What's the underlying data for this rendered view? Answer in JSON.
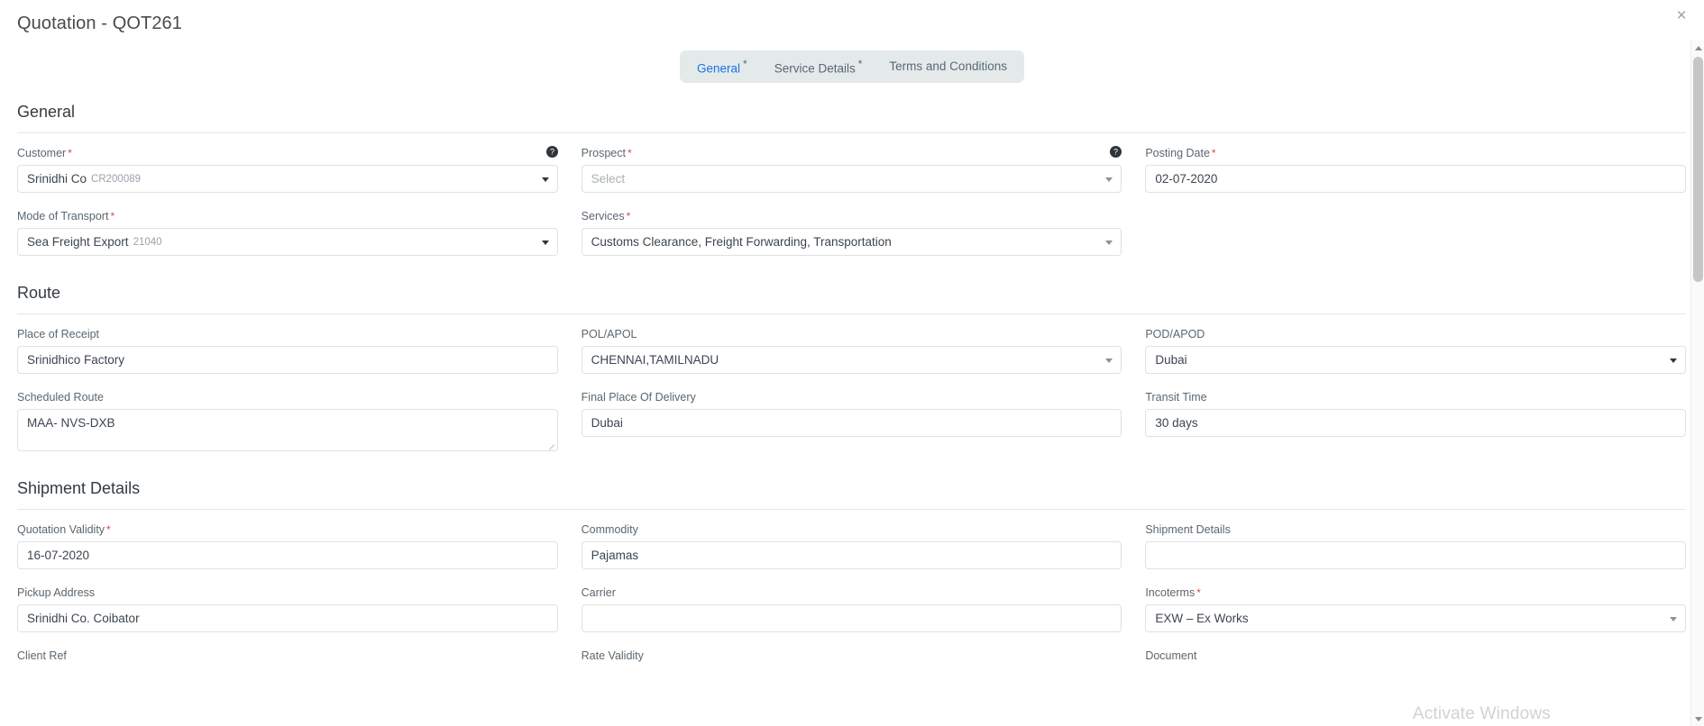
{
  "window": {
    "title": "Quotation - QOT261",
    "close_label": "×"
  },
  "tabs": [
    {
      "label": "General",
      "required_mark": "*",
      "active": true
    },
    {
      "label": "Service Details",
      "required_mark": "*",
      "active": false
    },
    {
      "label": "Terms and Conditions",
      "required_mark": "",
      "active": false
    }
  ],
  "sections": {
    "general": {
      "title": "General",
      "fields": {
        "customer": {
          "label": "Customer",
          "required": "*",
          "value": "Srinidhi Co",
          "value_code": "CR200089",
          "help": "help-icon"
        },
        "prospect": {
          "label": "Prospect",
          "required": "*",
          "placeholder": "Select",
          "help": "help-icon"
        },
        "posting_date": {
          "label": "Posting Date",
          "required": "*",
          "value": "02-07-2020"
        },
        "mode_of_transport": {
          "label": "Mode of Transport",
          "required": "*",
          "value": "Sea Freight Export",
          "value_code": "21040"
        },
        "services": {
          "label": "Services",
          "required": "*",
          "value": "Customs Clearance, Freight Forwarding, Transportation"
        }
      }
    },
    "route": {
      "title": "Route",
      "fields": {
        "place_of_receipt": {
          "label": "Place of Receipt",
          "value": "Srinidhico Factory"
        },
        "pol_apol": {
          "label": "POL/APOL",
          "value": "CHENNAI,TAMILNADU"
        },
        "pod_apod": {
          "label": "POD/APOD",
          "value": "Dubai"
        },
        "scheduled_route": {
          "label": "Scheduled Route",
          "value": "MAA- NVS-DXB"
        },
        "final_place_of_delivery": {
          "label": "Final Place Of Delivery",
          "value": "Dubai"
        },
        "transit_time": {
          "label": "Transit Time",
          "value": "30 days"
        }
      }
    },
    "shipment_details": {
      "title": "Shipment Details",
      "fields": {
        "quotation_validity": {
          "label": "Quotation Validity",
          "required": "*",
          "value": "16-07-2020"
        },
        "commodity": {
          "label": "Commodity",
          "value": "Pajamas"
        },
        "shipment_details": {
          "label": "Shipment Details",
          "value": ""
        },
        "pickup_address": {
          "label": "Pickup Address",
          "value": "Srinidhi Co. Coibator"
        },
        "carrier": {
          "label": "Carrier",
          "value": ""
        },
        "incoterms": {
          "label": "Incoterms",
          "required": "*",
          "value": "EXW – Ex Works"
        },
        "client_ref": {
          "label": "Client Ref"
        },
        "rate_validity": {
          "label": "Rate Validity"
        },
        "document": {
          "label": "Document"
        }
      }
    }
  },
  "scrollbar": {
    "up_arrow": "chevron-up-icon",
    "down_arrow": "chevron-down-icon"
  },
  "watermark": "Activate Windows"
}
